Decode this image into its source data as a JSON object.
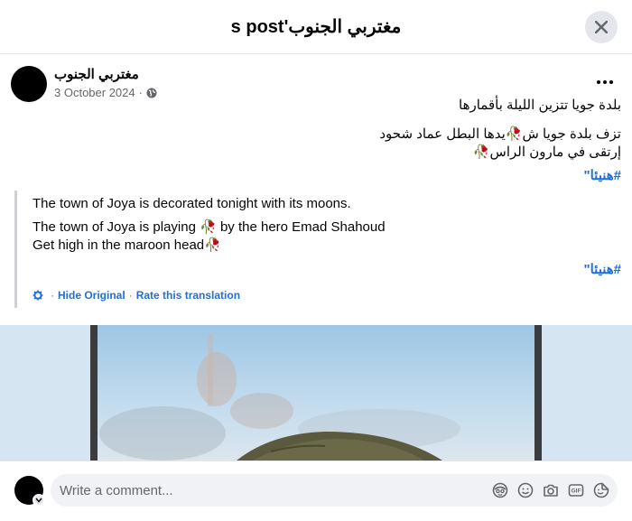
{
  "header": {
    "title": "s post'مغتربي الجنوب"
  },
  "post": {
    "author": "مغتربي الجنوب",
    "date": "3 October 2024",
    "meta_sep": "·",
    "line1": "بلدة جويا تتزين الليلة بأقمارها",
    "line2": "تزف بلدة جويا ش🥀يدها البطل عماد شحود",
    "line3": "إرتقى في مارون الراس🥀",
    "hashtag": "#هنيئا\""
  },
  "translation": {
    "line1": "The town of Joya is decorated tonight with its moons.",
    "line2": "The town of Joya is playing 🥀 by the hero Emad Shahoud",
    "line3": "Get high in the maroon head🥀",
    "hashtag": "#هنيئا\"",
    "hide_label": "Hide Original",
    "sep": "·",
    "rate_label": "Rate this translation"
  },
  "composer": {
    "placeholder": "Write a comment..."
  },
  "icons": {
    "close": "close-icon",
    "more": "more-icon",
    "globe": "globe-icon",
    "gear": "gear-icon",
    "avatar_sticker": "avatar-sticker-icon",
    "emoji": "emoji-icon",
    "camera": "camera-icon",
    "gif": "gif-icon",
    "sticker": "sticker-icon"
  },
  "colors": {
    "link": "#216fdb",
    "muted": "#65676b",
    "divider": "#e4e6eb"
  }
}
